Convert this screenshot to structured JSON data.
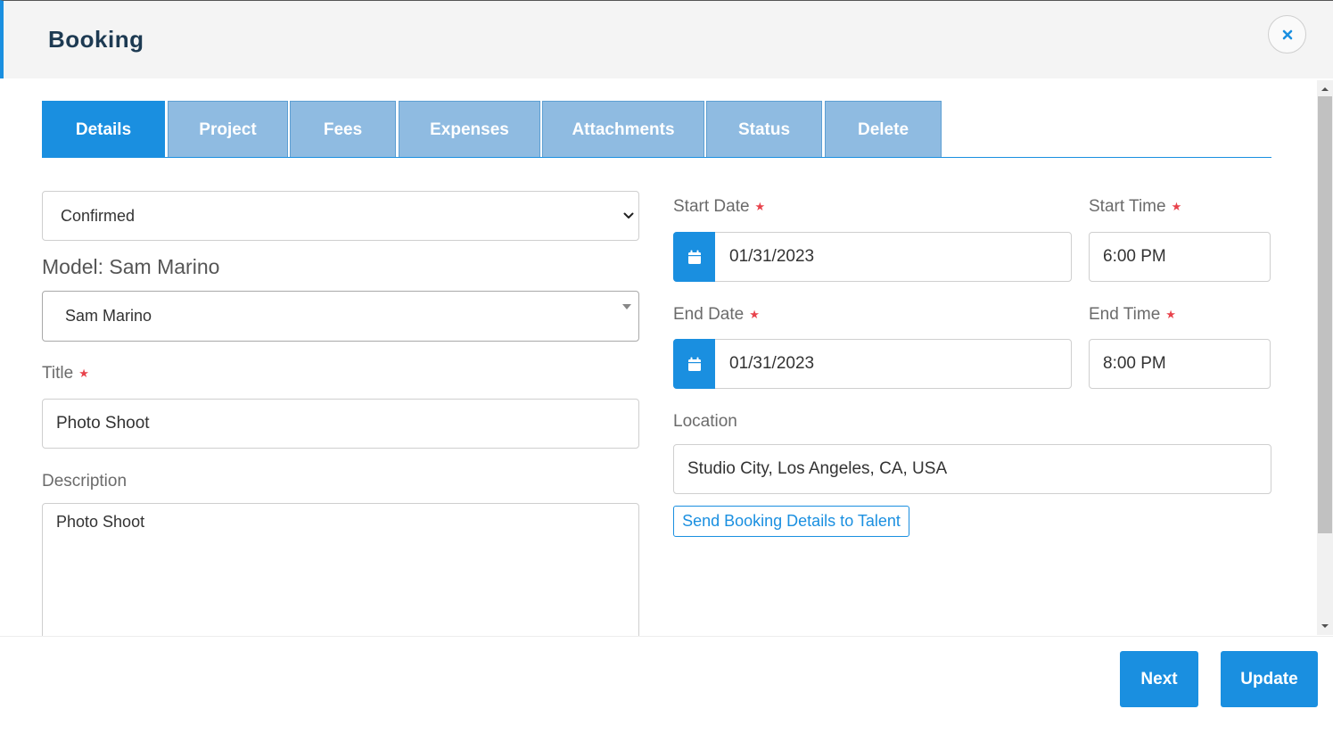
{
  "header": {
    "title": "Booking",
    "close_icon": "close-icon"
  },
  "tabs": [
    {
      "label": "Details",
      "active": true
    },
    {
      "label": "Project"
    },
    {
      "label": "Fees"
    },
    {
      "label": "Expenses"
    },
    {
      "label": "Attachments"
    },
    {
      "label": "Status"
    },
    {
      "label": "Delete"
    }
  ],
  "left": {
    "status_select": {
      "value": "Confirmed"
    },
    "model_heading": "Model: Sam Marino",
    "model_select": {
      "value": "Sam Marino"
    },
    "title_label": "Title",
    "title_value": "Photo Shoot",
    "description_label": "Description",
    "description_value": "Photo Shoot"
  },
  "right": {
    "start_date_label": "Start Date",
    "start_date_value": "01/31/2023",
    "start_time_label": "Start Time",
    "start_time_value": "6:00 PM",
    "end_date_label": "End Date",
    "end_date_value": "01/31/2023",
    "end_time_label": "End Time",
    "end_time_value": "8:00 PM",
    "location_label": "Location",
    "location_value": "Studio City, Los Angeles, CA, USA",
    "send_button": "Send Booking Details to Talent"
  },
  "required_mark": "★",
  "footer": {
    "next_label": "Next",
    "update_label": "Update"
  },
  "colors": {
    "accent": "#1a8fe0",
    "tab_inactive": "#8fbbe1",
    "required": "#e8434c",
    "title": "#1d3a52"
  }
}
